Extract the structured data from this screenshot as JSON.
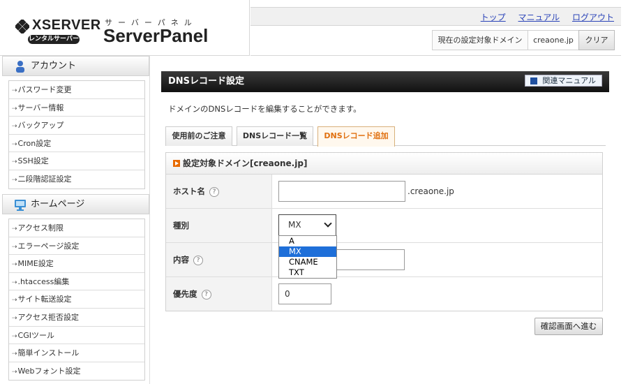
{
  "header": {
    "brand": "XSERVER",
    "brand_badge": "レンタルサーバー",
    "panel_kana": "サーバーパネル",
    "panel_title": "ServerPanel",
    "links": [
      "トップ",
      "マニュアル",
      "ログアウト"
    ],
    "domain_label": "現在の設定対象ドメイン",
    "domain_value": "creaone.jp",
    "clear_label": "クリア"
  },
  "sidebar": {
    "account_heading": "アカウント",
    "account_items": [
      "パスワード変更",
      "サーバー情報",
      "バックアップ",
      "Cron設定",
      "SSH設定",
      "二段階認証設定"
    ],
    "homepage_heading": "ホームページ",
    "homepage_items": [
      "アクセス制限",
      "エラーページ設定",
      "MIME設定",
      ".htaccess編集",
      "サイト転送設定",
      "アクセス拒否設定",
      "CGIツール",
      "簡単インストール",
      "Webフォント設定"
    ]
  },
  "main": {
    "title": "DNSレコード設定",
    "manual_button": "関連マニュアル",
    "description": "ドメインのDNSレコードを編集することができます。",
    "tabs": [
      "使用前のご注意",
      "DNSレコード一覧",
      "DNSレコード追加"
    ],
    "active_tab": 2,
    "panel_heading": "設定対象ドメイン[creaone.jp]",
    "form": {
      "host_label": "ホスト名",
      "host_value": "",
      "host_suffix": ".creaone.jp",
      "type_label": "種別",
      "type_value": "MX",
      "type_options": [
        "A",
        "MX",
        "CNAME",
        "TXT"
      ],
      "type_highlighted": "MX",
      "content_label": "内容",
      "content_value": "",
      "priority_label": "優先度",
      "priority_value": "0",
      "help_mark": "?"
    },
    "confirm_button": "確認画面へ進む"
  },
  "colors": {
    "accent_orange": "#e07010",
    "link_blue": "#2a43b8",
    "highlight_blue": "#1e6fd9",
    "title_bar": "#1a1a1a"
  }
}
